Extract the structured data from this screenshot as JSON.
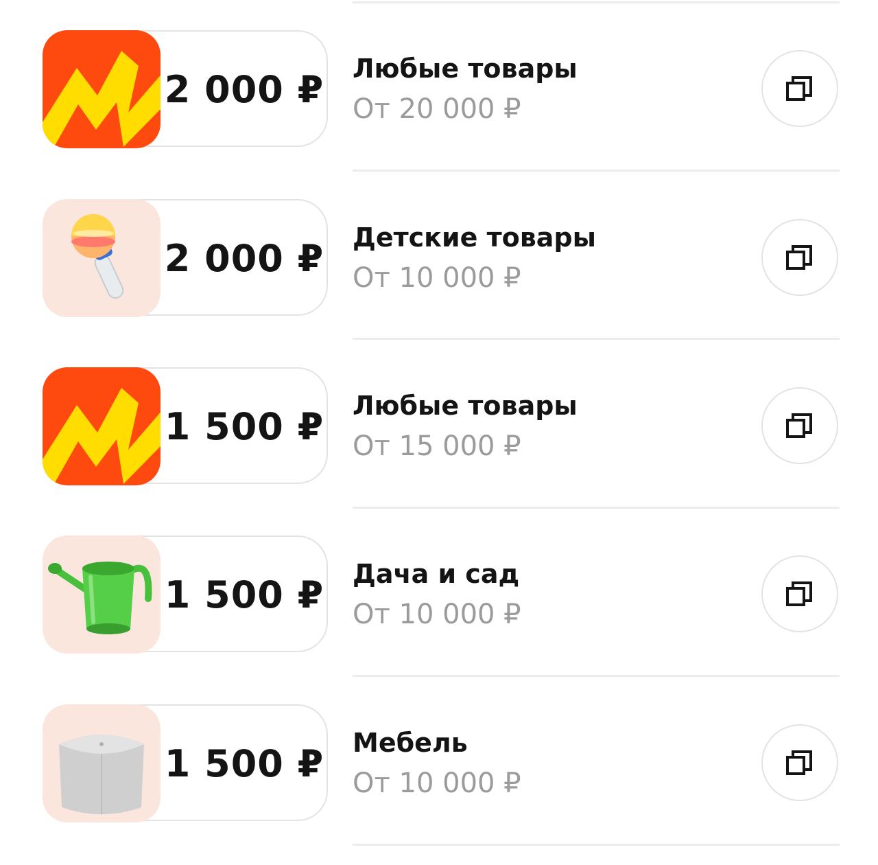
{
  "coupons": [
    {
      "amount": "2 000 ₽",
      "category": "Любые товары",
      "condition": "От 20 000 ₽",
      "image": "yandex-market-logo",
      "copy_icon": "copy-icon"
    },
    {
      "amount": "2 000 ₽",
      "category": "Детские товары",
      "condition": "От 10 000 ₽",
      "image": "baby-rattle",
      "copy_icon": "copy-icon"
    },
    {
      "amount": "1 500 ₽",
      "category": "Любые товары",
      "condition": "От 15 000 ₽",
      "image": "yandex-market-logo",
      "copy_icon": "copy-icon"
    },
    {
      "amount": "1 500 ₽",
      "category": "Дача и сад",
      "condition": "От 10 000 ₽",
      "image": "watering-can",
      "copy_icon": "copy-icon"
    },
    {
      "amount": "1 500 ₽",
      "category": "Мебель",
      "condition": "От 10 000 ₽",
      "image": "pouf",
      "copy_icon": "copy-icon"
    }
  ],
  "colors": {
    "logo_red": "#ff4a0f",
    "logo_yellow": "#ffdd00",
    "thumb_peach": "#fbe6dd",
    "muted_text": "#9b9b9b",
    "border": "#e3e3e3"
  }
}
